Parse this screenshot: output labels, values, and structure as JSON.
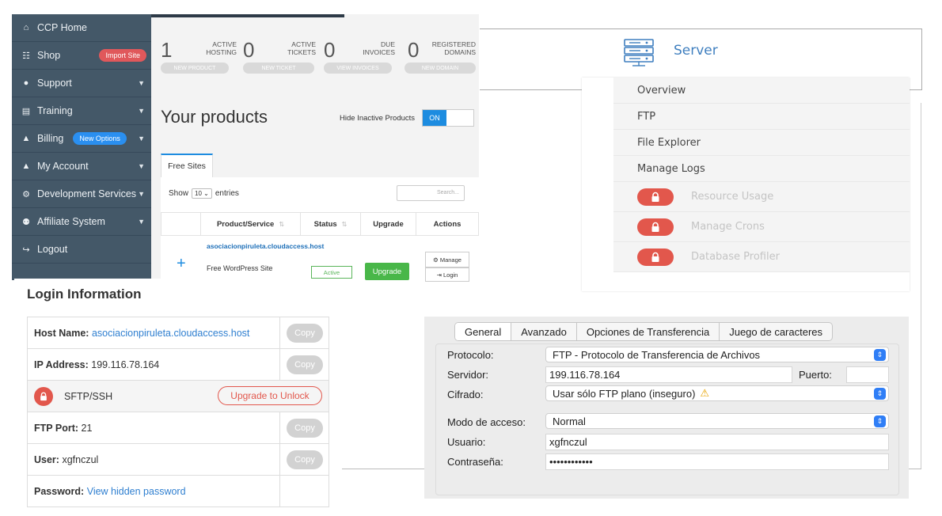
{
  "sidebar": {
    "items": [
      {
        "label": "CCP Home",
        "icon": "home-icon",
        "glyph": "⌂"
      },
      {
        "label": "Shop",
        "icon": "cart-icon",
        "glyph": "☷",
        "badge": "Import Site"
      },
      {
        "label": "Support",
        "icon": "chat-icon",
        "glyph": "●",
        "chevron": true
      },
      {
        "label": "Training",
        "icon": "book-icon",
        "glyph": "▤",
        "chevron": true
      },
      {
        "label": "Billing",
        "icon": "user-icon",
        "glyph": "▲",
        "badge": "New Options",
        "chevron": true
      },
      {
        "label": "My Account",
        "icon": "user-icon",
        "glyph": "▲",
        "chevron": true
      },
      {
        "label": "Development Services",
        "icon": "cogs-icon",
        "glyph": "⚙",
        "chevron": true
      },
      {
        "label": "Affiliate System",
        "icon": "users-icon",
        "glyph": "⚉",
        "chevron": true
      },
      {
        "label": "Logout",
        "icon": "logout-icon",
        "glyph": "↪"
      }
    ]
  },
  "dashboard": {
    "stats": [
      {
        "number": "1",
        "label_line1": "ACTIVE",
        "label_line2": "HOSTING",
        "button": "NEW PRODUCT"
      },
      {
        "number": "0",
        "label_line1": "ACTIVE",
        "label_line2": "TICKETS",
        "button": "NEW TICKET"
      },
      {
        "number": "0",
        "label_line1": "DUE",
        "label_line2": "INVOICES",
        "button": "VIEW INVOICES"
      },
      {
        "number": "0",
        "label_line1": "REGISTERED",
        "label_line2": "DOMAINS",
        "button": "NEW DOMAIN"
      }
    ],
    "products_title": "Your products",
    "hide_inactive_label": "Hide Inactive Products",
    "toggle_state": "ON",
    "tab_label": "Free Sites",
    "show_label": "Show",
    "show_value": "10",
    "entries_label": "entries",
    "search_placeholder": "Search...",
    "columns": [
      "Product/Service",
      "Status",
      "Upgrade",
      "Actions"
    ],
    "row": {
      "product": "asociacionpiruleta.cloudaccess.host",
      "description": "Free WordPress Site",
      "status": "Active",
      "upgrade": "Upgrade",
      "manage": "Manage",
      "login": "Login"
    }
  },
  "server": {
    "title": "Server",
    "menu": [
      "Overview",
      "FTP",
      "File Explorer",
      "Manage Logs"
    ],
    "locked_menu": [
      "Resource Usage",
      "Manage Crons",
      "Database Profiler"
    ]
  },
  "login_info": {
    "title": "Login Information",
    "host_label": "Host Name:",
    "host_value": "asociacionpiruleta.cloudaccess.host",
    "ip_label": "IP Address:",
    "ip_value": "199.116.78.164",
    "sftp_label": "SFTP/SSH",
    "upgrade_unlock": "Upgrade to Unlock",
    "ftp_port_label": "FTP Port:",
    "ftp_port_value": "21",
    "user_label": "User:",
    "user_value": "xgfnczul",
    "password_label": "Password:",
    "password_link": "View hidden password",
    "copy_label": "Copy"
  },
  "ftp_dialog": {
    "tabs": [
      "General",
      "Avanzado",
      "Opciones de Transferencia",
      "Juego de caracteres"
    ],
    "protocol_label": "Protocolo:",
    "protocol_value": "FTP - Protocolo de Transferencia de Archivos",
    "server_label": "Servidor:",
    "server_value": "199.116.78.164",
    "port_label": "Puerto:",
    "port_value": "",
    "encryption_label": "Cifrado:",
    "encryption_value": "Usar sólo FTP plano (inseguro)",
    "access_mode_label": "Modo de acceso:",
    "access_mode_value": "Normal",
    "user_label": "Usuario:",
    "user_value": "xgfnczul",
    "password_label": "Contraseña:",
    "password_value": "••••••••••••"
  },
  "colors": {
    "sidebar_bg": "#445868",
    "accent_blue": "#1d8ce0",
    "lock_red": "#e2574c",
    "upgrade_green": "#49b749"
  }
}
